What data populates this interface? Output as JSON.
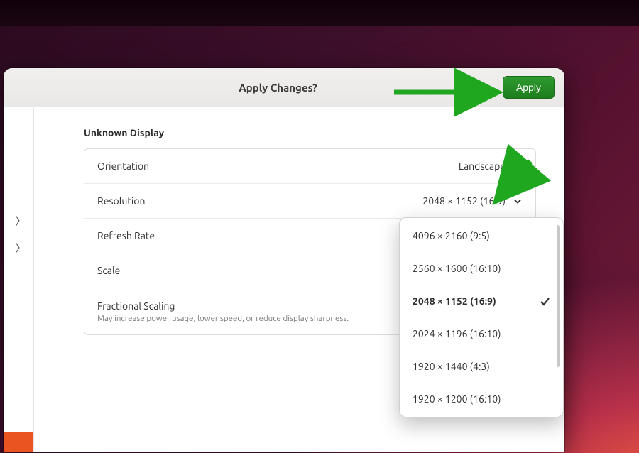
{
  "colors": {
    "accent": "#e95420",
    "apply": "#1e7e1e",
    "annotation": "#1fa81f"
  },
  "header": {
    "title": "Apply Changes?",
    "apply_label": "Apply"
  },
  "section": {
    "title": "Unknown Display"
  },
  "rows": {
    "orientation": {
      "label": "Orientation",
      "value": "Landscape"
    },
    "resolution": {
      "label": "Resolution",
      "value": "2048 × 1152 (16:9)"
    },
    "refresh": {
      "label": "Refresh Rate"
    },
    "scale": {
      "label": "Scale"
    },
    "fractional": {
      "label": "Fractional Scaling",
      "sub": "May increase power usage, lower speed, or reduce display sharpness."
    }
  },
  "resolution_menu": {
    "selected_index": 2,
    "options": [
      "4096 × 2160 (9:5)",
      "2560 × 1600 (16:10)",
      "2048 × 1152 (16:9)",
      "2024 × 1196 (16:10)",
      "1920 × 1440 (4:3)",
      "1920 × 1200 (16:10)"
    ]
  }
}
